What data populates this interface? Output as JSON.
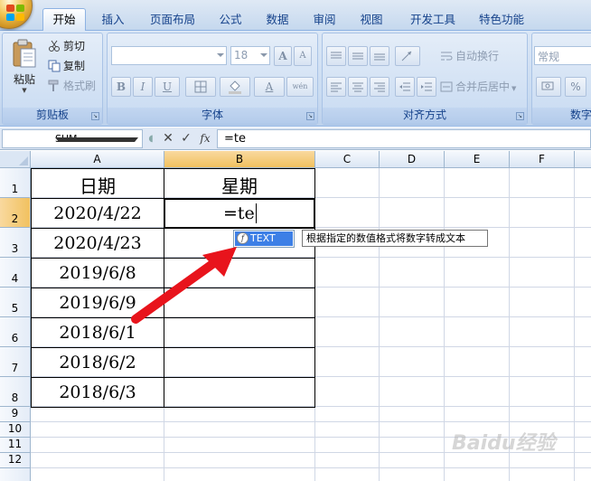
{
  "tabs": [
    "开始",
    "插入",
    "页面布局",
    "公式",
    "数据",
    "审阅",
    "视图",
    "开发工具",
    "特色功能"
  ],
  "active_tab_index": 0,
  "ribbon": {
    "clipboard": {
      "paste": "粘贴",
      "cut": "剪切",
      "copy": "复制",
      "format_painter": "格式刷",
      "label": "剪贴板"
    },
    "font": {
      "font_name": "",
      "font_size": "18",
      "grow": "A",
      "shrink": "A",
      "bold": "B",
      "italic": "I",
      "underline": "U",
      "font_color": "A",
      "phonetic": "wén",
      "label": "字体"
    },
    "alignment": {
      "wrap": "自动换行",
      "merge": "合并后居中",
      "label": "对齐方式"
    },
    "number": {
      "format": "常规",
      "percent": "%",
      "label": "数字"
    }
  },
  "formula_bar": {
    "name_box": "SUM",
    "cancel": "✕",
    "enter": "✓",
    "fx": "fx",
    "content": "=te"
  },
  "columns": [
    "A",
    "B",
    "C",
    "D",
    "E",
    "F"
  ],
  "selected_column": "B",
  "rows": [
    "1",
    "2",
    "3",
    "4",
    "5",
    "6",
    "7",
    "8",
    "9",
    "10",
    "11",
    "12"
  ],
  "selected_row": "2",
  "table": {
    "headers": [
      "日期",
      "星期"
    ],
    "dates": [
      "2020/4/22",
      "2020/4/23",
      "2019/6/8",
      "2019/6/9",
      "2018/6/1",
      "2018/6/2",
      "2018/6/3"
    ],
    "editing_cell_value": "=te"
  },
  "autocomplete": {
    "function_name": "TEXT",
    "tooltip": "根据指定的数值格式将数字转成文本"
  },
  "watermark": "Baidu经验",
  "colors": {
    "ribbon_text": "#15428b",
    "selected_header": "#f1c15f",
    "arrow": "#e8141c",
    "autocomplete_highlight": "#3d7fe6"
  }
}
